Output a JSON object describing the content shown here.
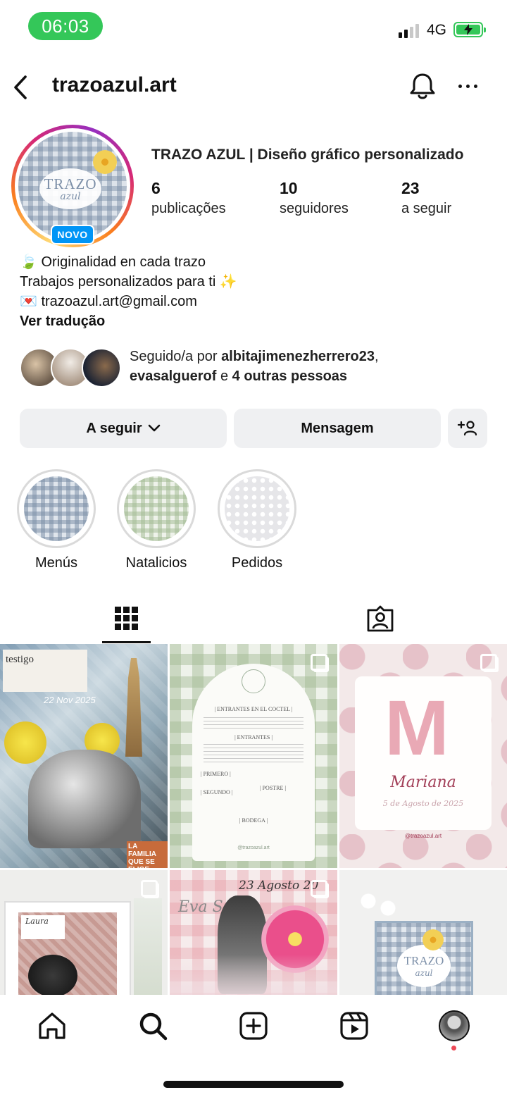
{
  "status_bar": {
    "time": "06:03",
    "network": "4G"
  },
  "header": {
    "username": "trazoazul.art"
  },
  "profile": {
    "avatar_logo_top": "TRAZO",
    "avatar_logo_bottom": "azul",
    "new_badge": "NOVO",
    "display_name": "TRAZO AZUL | Diseño gráfico personalizado",
    "stats": [
      {
        "count": "6",
        "label": "publicações"
      },
      {
        "count": "10",
        "label": "seguidores"
      },
      {
        "count": "23",
        "label": "a seguir"
      }
    ],
    "bio": {
      "line1_emoji": "🍃",
      "line1": "Originalidad en cada trazo",
      "line2": "Trabajos personalizados para ti",
      "line2_emoji": "✨",
      "line3_emoji": "💌",
      "line3": "trazoazul.art@gmail.com",
      "translate": "Ver tradução"
    },
    "followed_by": {
      "prefix": "Seguido/a por",
      "user1": "albitajimenezherrero23",
      "sep": ",",
      "user2": "evasalguerof",
      "conj": "e",
      "others": "4 outras pessoas"
    }
  },
  "actions": {
    "following": "A seguir",
    "message": "Mensagem"
  },
  "highlights": [
    {
      "label": "Menús",
      "color": "#9fb1c6"
    },
    {
      "label": "Natalicios",
      "color": "#c6d6bd"
    },
    {
      "label": "Pedidos",
      "color": "#c8c8cc"
    }
  ],
  "posts": {
    "p1_title": "testigo",
    "p1_date": "22 Nov 2025",
    "p1_tag": "LA FAMILIA QUE SE ELIGE",
    "p2_head": "| ENTRANTES EN EL COCTEL |",
    "p2_sections": [
      "| ENTRANTES |",
      "| PRIMERO |",
      "| POSTRE |",
      "| SEGUNDO |",
      "| BODEGA |"
    ],
    "p2_footer": "@trazoazul.art",
    "p3_letter": "M",
    "p3_name": "Mariana",
    "p3_date": "5 de Agosto de 2025",
    "p3_footer": "@trazoazul.art",
    "p4_name": "Laura",
    "p5_date": "23 Agosto 20",
    "p5_name": "Eva S.F",
    "p6_logo": "TRAZO",
    "p6_logo2": "azul"
  },
  "colors": {
    "accent_blue": "#0095f6",
    "notification_dot": "#ed4956",
    "time_pill": "#34c759"
  }
}
